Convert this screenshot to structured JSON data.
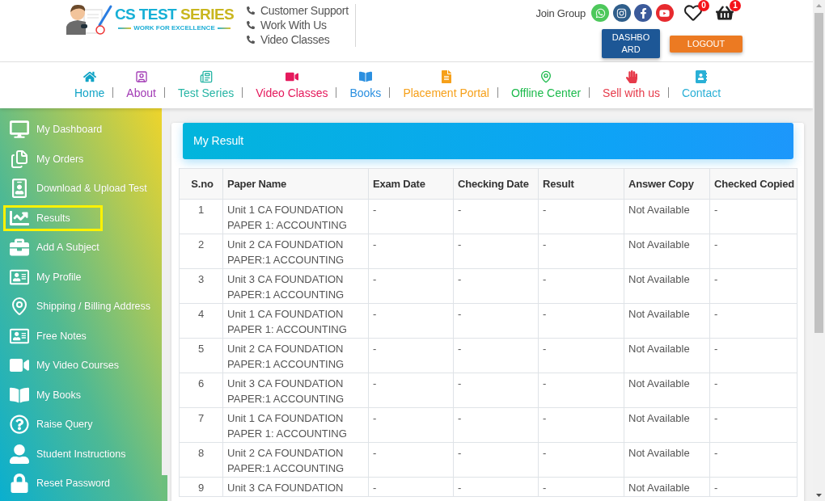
{
  "header": {
    "logo": {
      "brand": "CS TEST",
      "brand_accent": "SERIES",
      "tagline": "WORK FOR EXCELLENCE"
    },
    "contacts": [
      {
        "label": "Customer Support"
      },
      {
        "label": "Work With Us"
      },
      {
        "label": "Video Classes"
      }
    ],
    "join_group": {
      "label": "Join Group",
      "socials": [
        {
          "kind": "whatsapp"
        },
        {
          "kind": "instagram"
        },
        {
          "kind": "facebook"
        },
        {
          "kind": "youtube"
        }
      ]
    },
    "wishlist": {
      "count": "0"
    },
    "cart": {
      "count": "1"
    },
    "buttons": [
      {
        "kind": "dashboard",
        "label": "DASHBOARD"
      },
      {
        "kind": "logout",
        "label": "LOGOUT"
      }
    ]
  },
  "nav": [
    {
      "label": "Home",
      "color": "#12a4c6"
    },
    {
      "label": "About",
      "color": "#a23bb5"
    },
    {
      "label": "Test Series",
      "color": "#27b5a5"
    },
    {
      "label": "Video Classes",
      "color": "#e5195c"
    },
    {
      "label": "Books",
      "color": "#2a8fe0"
    },
    {
      "label": "Placement Portal",
      "color": "#f6a01a"
    },
    {
      "label": "Offline Center",
      "color": "#1cba4c"
    },
    {
      "label": "Sell with us",
      "color": "#e63a4a"
    },
    {
      "label": "Contact",
      "color": "#2ab0d6"
    }
  ],
  "sidebar": {
    "items": [
      {
        "label": "My Dashboard",
        "selected": false
      },
      {
        "label": "My Orders",
        "selected": false
      },
      {
        "label": "Download & Upload Test",
        "selected": false
      },
      {
        "label": "Results",
        "selected": true
      },
      {
        "label": "Add A Subject",
        "selected": false
      },
      {
        "label": "My Profile",
        "selected": false
      },
      {
        "label": "Shipping / Billing Address",
        "selected": false
      },
      {
        "label": "Free Notes",
        "selected": false
      },
      {
        "label": "My Video Courses",
        "selected": false
      },
      {
        "label": "My Books",
        "selected": false
      },
      {
        "label": "Raise Query",
        "selected": false
      },
      {
        "label": "Student Instructions",
        "selected": false
      },
      {
        "label": "Reset Password",
        "selected": false
      }
    ]
  },
  "result": {
    "title": "My Result",
    "table": {
      "columns": [
        "S.no",
        "Paper Name",
        "Exam Date",
        "Checking Date",
        "Result",
        "Answer Copy",
        "Checked Copied"
      ],
      "rows": [
        [
          "1",
          "Unit 1 CA FOUNDATION PAPER 1: ACCOUNTING",
          "-",
          "-",
          "-",
          "Not Available",
          "-"
        ],
        [
          "2",
          "Unit 2 CA FOUNDATION PAPER:1 ACCOUNTING",
          "-",
          "-",
          "-",
          "Not Available",
          "-"
        ],
        [
          "3",
          "Unit 3 CA FOUNDATION PAPER:1 ACCOUNTING",
          "-",
          "-",
          "-",
          "Not Available",
          "-"
        ],
        [
          "4",
          "Unit 1 CA FOUNDATION PAPER 1: ACCOUNTING",
          "-",
          "-",
          "-",
          "Not Available",
          "-"
        ],
        [
          "5",
          "Unit 2 CA FOUNDATION PAPER:1 ACCOUNTING",
          "-",
          "-",
          "-",
          "Not Available",
          "-"
        ],
        [
          "6",
          "Unit 3 CA FOUNDATION PAPER:1 ACCOUNTING",
          "-",
          "-",
          "-",
          "Not Available",
          "-"
        ],
        [
          "7",
          "Unit 1 CA FOUNDATION PAPER 1: ACCOUNTING",
          "-",
          "-",
          "-",
          "Not Available",
          "-"
        ],
        [
          "8",
          "Unit 2 CA FOUNDATION PAPER:1 ACCOUNTING",
          "-",
          "-",
          "-",
          "Not Available",
          "-"
        ],
        [
          "9",
          "Unit 3 CA FOUNDATION",
          "-",
          "-",
          "-",
          "Not Available",
          "-"
        ]
      ]
    }
  }
}
